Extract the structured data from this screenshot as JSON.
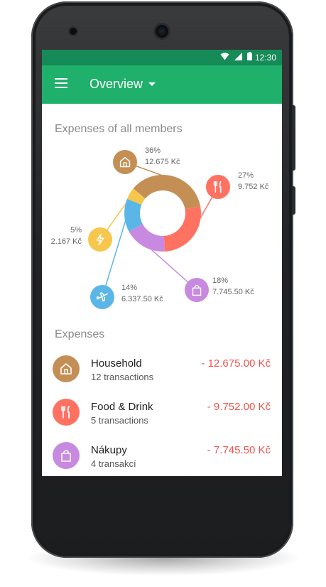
{
  "status": {
    "time": "12:30"
  },
  "toolbar": {
    "title": "Overview"
  },
  "section_chart_title": "Expenses of all members",
  "section_expenses_title": "Expenses",
  "chart_data": {
    "type": "pie",
    "title": "Expenses of all members",
    "series": [
      {
        "name": "",
        "percent_label": "36%",
        "amount_label": "12.675 Kč",
        "value": 36,
        "color": "#c48f55",
        "icon": "house-icon"
      },
      {
        "name": "",
        "percent_label": "27%",
        "amount_label": "9.752 Kč",
        "value": 27,
        "color": "#ff7161",
        "icon": "fork-knife-icon"
      },
      {
        "name": "",
        "percent_label": "18%",
        "amount_label": "7.745.50 Kč",
        "value": 18,
        "color": "#c78ae0",
        "icon": "shopping-bag-icon"
      },
      {
        "name": "",
        "percent_label": "14%",
        "amount_label": "6.337.50 Kč",
        "value": 14,
        "color": "#5bb6e8",
        "icon": "airplane-icon"
      },
      {
        "name": "",
        "percent_label": "5%",
        "amount_label": "2.167 Kč",
        "value": 5,
        "color": "#f7c74d",
        "icon": "lightning-icon"
      }
    ]
  },
  "expenses": [
    {
      "name": "Household",
      "sub": "12 transactions",
      "amount": "- 12.675.00 Kč",
      "color": "#c48f55",
      "icon": "house-icon"
    },
    {
      "name": "Food & Drink",
      "sub": "5 transactions",
      "amount": "- 9.752.00 Kč",
      "color": "#ff7161",
      "icon": "fork-knife-icon"
    },
    {
      "name": "Nákupy",
      "sub": "4 transakcí",
      "amount": "- 7.745.50 Kč",
      "color": "#c78ae0",
      "icon": "shopping-bag-icon"
    }
  ],
  "colors": {
    "statusbar": "#168a57",
    "toolbar": "#1fb06b",
    "amount": "#f0534c"
  }
}
